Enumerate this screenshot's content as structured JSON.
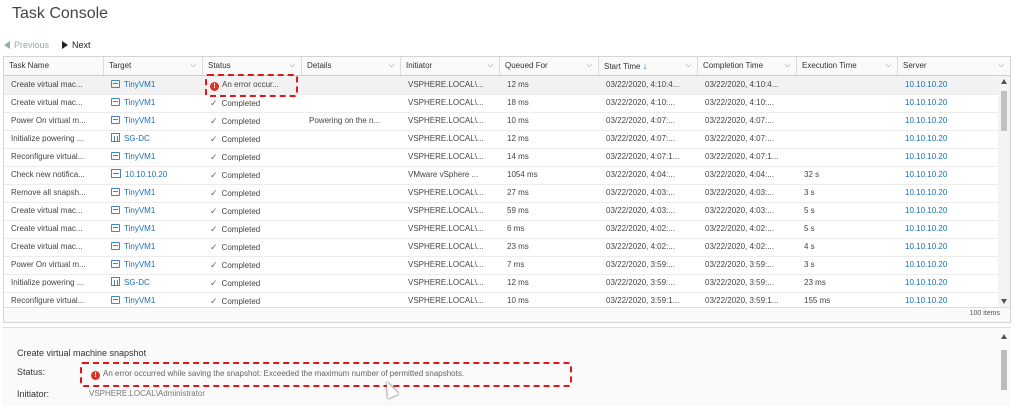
{
  "title": "Task Console",
  "nav": {
    "previous": "Previous",
    "next": "Next"
  },
  "columns": [
    {
      "key": "task",
      "label": "Task Name"
    },
    {
      "key": "target",
      "label": "Target"
    },
    {
      "key": "status",
      "label": "Status"
    },
    {
      "key": "details",
      "label": "Details"
    },
    {
      "key": "initiator",
      "label": "Initiator"
    },
    {
      "key": "queued",
      "label": "Queued For"
    },
    {
      "key": "start",
      "label": "Start Time"
    },
    {
      "key": "completion",
      "label": "Completion Time"
    },
    {
      "key": "execution",
      "label": "Execution Time"
    },
    {
      "key": "server",
      "label": "Server"
    }
  ],
  "rows": [
    {
      "task": "Create virtual mac...",
      "target": "TinyVM1",
      "target_icon": "vm",
      "status": "An error occur...",
      "status_type": "error",
      "details": "",
      "initiator": "VSPHERE.LOCAL\\...",
      "queued": "12 ms",
      "start": "03/22/2020, 4:10:4...",
      "completion": "03/22/2020, 4:10:4...",
      "execution": "",
      "server": "10.10.10.20"
    },
    {
      "task": "Create virtual mac...",
      "target": "TinyVM1",
      "target_icon": "vm",
      "status": "Completed",
      "status_type": "ok",
      "details": "",
      "initiator": "VSPHERE.LOCAL\\...",
      "queued": "18 ms",
      "start": "03/22/2020, 4:10:...",
      "completion": "03/22/2020, 4:10:...",
      "execution": "",
      "server": "10.10.10.20"
    },
    {
      "task": "Power On virtual m...",
      "target": "TinyVM1",
      "target_icon": "vm",
      "status": "Completed",
      "status_type": "ok",
      "details": "Powering on the n...",
      "initiator": "VSPHERE.LOCAL\\...",
      "queued": "10 ms",
      "start": "03/22/2020, 4:07:...",
      "completion": "03/22/2020, 4:07:...",
      "execution": "",
      "server": "10.10.10.20"
    },
    {
      "task": "Initialize powering ...",
      "target": "SG-DC",
      "target_icon": "dc",
      "status": "Completed",
      "status_type": "ok",
      "details": "",
      "initiator": "VSPHERE.LOCAL\\...",
      "queued": "12 ms",
      "start": "03/22/2020, 4:07:...",
      "completion": "03/22/2020, 4:07:...",
      "execution": "",
      "server": "10.10.10.20"
    },
    {
      "task": "Reconfigure virtual...",
      "target": "TinyVM1",
      "target_icon": "vm",
      "status": "Completed",
      "status_type": "ok",
      "details": "",
      "initiator": "VSPHERE.LOCAL\\...",
      "queued": "14 ms",
      "start": "03/22/2020, 4:07:1...",
      "completion": "03/22/2020, 4:07:1...",
      "execution": "",
      "server": "10.10.10.20"
    },
    {
      "task": "Check new notifica...",
      "target": "10.10.10.20",
      "target_icon": "host",
      "status": "Completed",
      "status_type": "ok",
      "details": "",
      "initiator": "VMware vSphere ...",
      "queued": "1054 ms",
      "start": "03/22/2020, 4:04:...",
      "completion": "03/22/2020, 4:04:...",
      "execution": "32 s",
      "server": "10.10.10.20"
    },
    {
      "task": "Remove all snapsh...",
      "target": "TinyVM1",
      "target_icon": "vm",
      "status": "Completed",
      "status_type": "ok",
      "details": "",
      "initiator": "VSPHERE.LOCAL\\...",
      "queued": "27 ms",
      "start": "03/22/2020, 4:03:...",
      "completion": "03/22/2020, 4:03:...",
      "execution": "3 s",
      "server": "10.10.10.20"
    },
    {
      "task": "Create virtual mac...",
      "target": "TinyVM1",
      "target_icon": "vm",
      "status": "Completed",
      "status_type": "ok",
      "details": "",
      "initiator": "VSPHERE.LOCAL\\...",
      "queued": "59 ms",
      "start": "03/22/2020, 4:03:...",
      "completion": "03/22/2020, 4:03:...",
      "execution": "5 s",
      "server": "10.10.10.20"
    },
    {
      "task": "Create virtual mac...",
      "target": "TinyVM1",
      "target_icon": "vm",
      "status": "Completed",
      "status_type": "ok",
      "details": "",
      "initiator": "VSPHERE.LOCAL\\...",
      "queued": "6 ms",
      "start": "03/22/2020, 4:02:...",
      "completion": "03/22/2020, 4:02:...",
      "execution": "5 s",
      "server": "10.10.10.20"
    },
    {
      "task": "Create virtual mac...",
      "target": "TinyVM1",
      "target_icon": "vm",
      "status": "Completed",
      "status_type": "ok",
      "details": "",
      "initiator": "VSPHERE.LOCAL\\...",
      "queued": "23 ms",
      "start": "03/22/2020, 4:02:...",
      "completion": "03/22/2020, 4:02:...",
      "execution": "4 s",
      "server": "10.10.10.20"
    },
    {
      "task": "Power On virtual m...",
      "target": "TinyVM1",
      "target_icon": "vm",
      "status": "Completed",
      "status_type": "ok",
      "details": "",
      "initiator": "VSPHERE.LOCAL\\...",
      "queued": "7 ms",
      "start": "03/22/2020, 3:59:...",
      "completion": "03/22/2020, 3:59:...",
      "execution": "3 s",
      "server": "10.10.10.20"
    },
    {
      "task": "Initialize powering ...",
      "target": "SG-DC",
      "target_icon": "dc",
      "status": "Completed",
      "status_type": "ok",
      "details": "",
      "initiator": "VSPHERE.LOCAL\\...",
      "queued": "12 ms",
      "start": "03/22/2020, 3:59:...",
      "completion": "03/22/2020, 3:59:...",
      "execution": "23 ms",
      "server": "10.10.10.20"
    },
    {
      "task": "Reconfigure virtual...",
      "target": "TinyVM1",
      "target_icon": "vm",
      "status": "Completed",
      "status_type": "ok",
      "details": "",
      "initiator": "VSPHERE.LOCAL\\...",
      "queued": "10 ms",
      "start": "03/22/2020, 3:59:1...",
      "completion": "03/22/2020, 3:59:1...",
      "execution": "155 ms",
      "server": "10.10.10.20"
    }
  ],
  "footer": {
    "count": "100 items"
  },
  "detail": {
    "title": "Create virtual machine snapshot",
    "status_label": "Status:",
    "status_value": "An error occurred while saving the snapshot: Exceeded the maximum number of permitted snapshots.",
    "initiator_label": "Initiator:",
    "initiator_value": "VSPHERE.LOCAL\\Administrator"
  },
  "colors": {
    "error": "#d8322a",
    "link": "#1a6fb4",
    "highlight": "#e0161b"
  },
  "icons": {
    "error": "error-icon",
    "ok": "check-icon",
    "vm": "vm-icon",
    "dc": "datacenter-icon",
    "host": "host-icon"
  }
}
